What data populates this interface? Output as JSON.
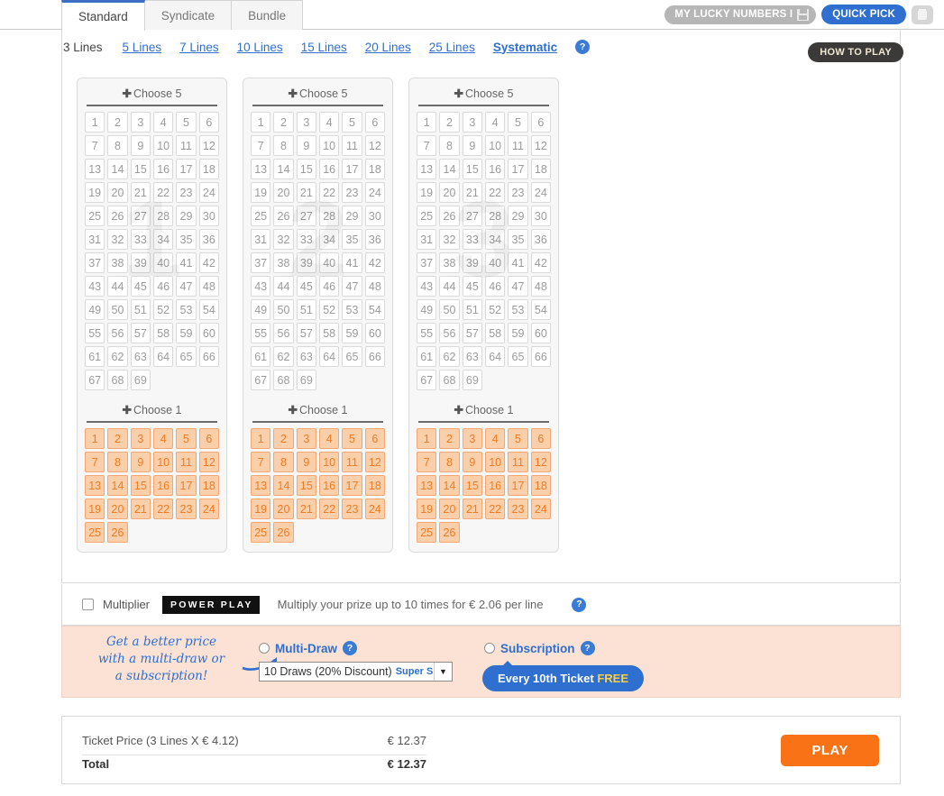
{
  "tabs": [
    {
      "label": "Standard",
      "active": true
    },
    {
      "label": "Syndicate",
      "active": false
    },
    {
      "label": "Bundle",
      "active": false
    }
  ],
  "topbar": {
    "lucky_numbers_label": "MY LUCKY NUMBERS I",
    "quick_pick_label": "QUICK PICK",
    "trash_icon": "trash-icon",
    "save_icon": "floppy-disk-icon"
  },
  "how_to_play_label": "HOW TO PLAY",
  "lines_selector": {
    "current": "3 Lines",
    "options": [
      "5 Lines",
      "7 Lines",
      "10 Lines",
      "15 Lines",
      "20 Lines",
      "25 Lines"
    ],
    "systematic": "Systematic",
    "help_icon": "question-mark-icon"
  },
  "panels": [
    {
      "watermark": "1",
      "main_header": "Choose 5",
      "bonus_header": "Choose 1"
    },
    {
      "watermark": "2",
      "main_header": "Choose 5",
      "bonus_header": "Choose 1"
    },
    {
      "watermark": "3",
      "main_header": "Choose 5",
      "bonus_header": "Choose 1"
    }
  ],
  "grid": {
    "main_max": 69,
    "bonus_max": 26,
    "columns": 6,
    "plus_glyph": "✚"
  },
  "multiplier": {
    "label": "Multiplier",
    "badge": "POWER PLAY",
    "description": "Multiply your prize up to 10 times for € 2.06 per line",
    "checked": false,
    "help_icon": "question-mark-icon"
  },
  "promo": {
    "handwriting_line1": "Get a better price",
    "handwriting_line2": "with a multi-draw or",
    "handwriting_line3": "a subscription!",
    "arrow_icon": "curved-arrow-icon",
    "multi_draw_label": "Multi-Draw",
    "multi_draw_selected": false,
    "dropdown_value": "10 Draws (20% Discount)",
    "dropdown_tag": "Super S",
    "subscription_label": "Subscription",
    "subscription_selected": false,
    "pill_text": "Every 10th Ticket ",
    "pill_highlight": "FREE",
    "help_icon": "question-mark-icon"
  },
  "totals": {
    "ticket_price_label": "Ticket Price (3 Lines X € 4.12)",
    "ticket_price_value": "€ 12.37",
    "total_label": "Total",
    "total_value": "€ 12.37",
    "play_label": "PLAY"
  },
  "colors": {
    "accent_blue": "#2f6fd0",
    "orange": "#ef7c24",
    "orange_fill": "#fbcfa9",
    "play_orange": "#f97316",
    "promo_bg": "#fbe2d5",
    "dark_badge": "#3c3a38"
  }
}
